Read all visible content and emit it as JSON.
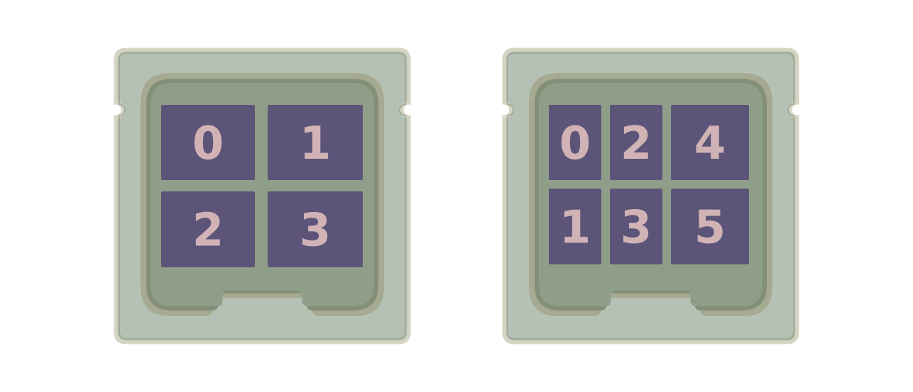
{
  "colors": {
    "background": "#ffffff",
    "card_fill": "#b5c1b5",
    "card_border": "#d6d4c3",
    "card_inner_line": "#9aa38b",
    "tray_outer": "#a5aa90",
    "tray_ring": "#838f76",
    "tray_fill": "#8f9e89",
    "cell_fill": "#5c5579",
    "cell_label": "#d1b3b6"
  },
  "panels": [
    {
      "name": "left-chip",
      "rows": [
        [
          "0",
          "1"
        ],
        [
          "2",
          "3"
        ]
      ]
    },
    {
      "name": "right-chip",
      "rows": [
        [
          "0",
          "2",
          "4"
        ],
        [
          "1",
          "3",
          "5"
        ]
      ]
    }
  ]
}
